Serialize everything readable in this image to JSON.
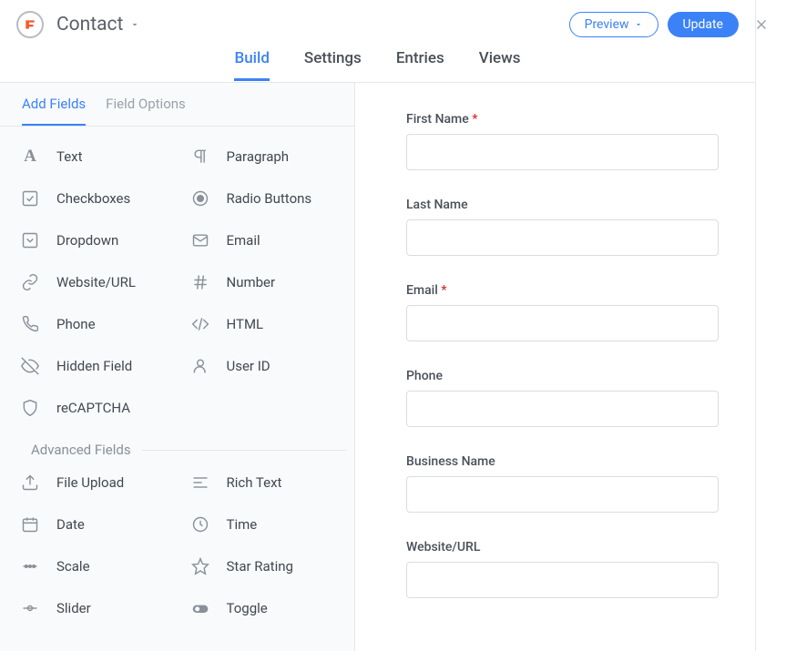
{
  "header": {
    "form_title": "Contact",
    "preview_label": "Preview",
    "update_label": "Update"
  },
  "nav": {
    "tabs": [
      "Build",
      "Settings",
      "Entries",
      "Views"
    ],
    "active_index": 0
  },
  "left_panel": {
    "tabs": [
      "Add Fields",
      "Field Options"
    ],
    "active_index": 0,
    "basic_fields": {
      "col1": [
        "Text",
        "Checkboxes",
        "Dropdown",
        "Website/URL",
        "Phone",
        "Hidden Field",
        "reCAPTCHA"
      ],
      "col2": [
        "Paragraph",
        "Radio Buttons",
        "Email",
        "Number",
        "HTML",
        "User ID"
      ]
    },
    "advanced_label": "Advanced Fields",
    "advanced_fields": {
      "col1": [
        "File Upload",
        "Date",
        "Scale",
        "Slider"
      ],
      "col2": [
        "Rich Text",
        "Time",
        "Star Rating",
        "Toggle"
      ]
    }
  },
  "form": {
    "fields": [
      {
        "label": "First Name",
        "required": true
      },
      {
        "label": "Last Name",
        "required": false
      },
      {
        "label": "Email",
        "required": true
      },
      {
        "label": "Phone",
        "required": false
      },
      {
        "label": "Business Name",
        "required": false
      },
      {
        "label": "Website/URL",
        "required": false
      }
    ]
  }
}
